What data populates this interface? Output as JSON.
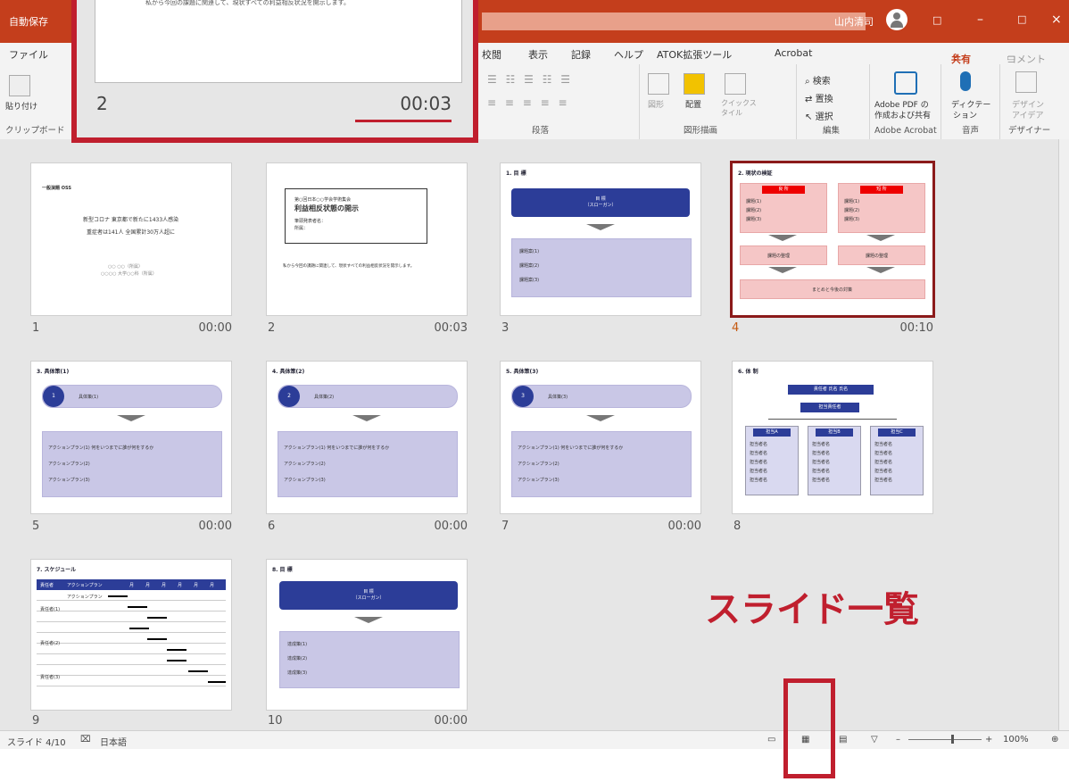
{
  "titlebar": {
    "autosave": "自動保存",
    "user_name": "山内清司",
    "btn_ribbon_display": "□",
    "btn_minimize": "–",
    "btn_maximize": "□",
    "btn_close": "×"
  },
  "ribbon_tabs": [
    "ファイル",
    "校閲",
    "表示",
    "記録",
    "ヘルプ",
    "ATOK拡張ツール",
    "Acrobat"
  ],
  "ribbon_right": {
    "share": "共有",
    "comment": "コメント"
  },
  "ribbon": {
    "paste": "貼り付け",
    "clipboard_label": "クリップボード",
    "paragraph_label": "段落",
    "shapes_label": "図形",
    "arrange": "配置",
    "quick_styles": "クイックスタイル",
    "drawing_label": "図形描画",
    "find": "検索",
    "replace": "置換",
    "select": "選択",
    "editing_label": "編集",
    "acrobat_btn_line1": "Adobe PDF の",
    "acrobat_btn_line2": "作成および共有",
    "acrobat_label": "Adobe Acrobat",
    "dictation_line1": "ディクテー",
    "dictation_line2": "ション",
    "voice_label": "音声",
    "designer_line1": "デザイン",
    "designer_line2": "アイデア",
    "designer_label": "デザイナー"
  },
  "zoom_overlay": {
    "caption": "私から今回の課題に関連して、現状すべての利益相反状況を開示します。",
    "number": "2",
    "time": "00:03"
  },
  "slides": [
    {
      "num": "1",
      "time": "00:00",
      "title": "一般演題 OSS",
      "lines": [
        "新型コロナ 東京都で新たに1433人感染",
        "重症者は141人 全国累計30万人超に"
      ],
      "footer": [
        "○○ ○○（所属）",
        "○○○○ 大学○○科（所属）"
      ]
    },
    {
      "num": "2",
      "time": "00:03",
      "box_title_small": "第○回日本○○学会学術集会",
      "box_title": "利益相反状態の開示",
      "box_lines": [
        "筆頭発表者名：",
        "所属："
      ],
      "caption": "私から今回の課題に関連して、現状すべての利益相反状況を開示します。"
    },
    {
      "num": "3",
      "time": "",
      "title": "1. 目 標",
      "blue_box": [
        "目 標",
        "（スローガン）"
      ],
      "items": [
        "課題案(1)",
        "課題案(2)",
        "課題案(3)"
      ]
    },
    {
      "num": "4",
      "time": "00:10",
      "title": "2. 現状の検証",
      "left_label": "良 所",
      "right_label": "短 所",
      "left_items": [
        "課題(1)",
        "課題(2)",
        "課題(3)"
      ],
      "right_items": [
        "課題(1)",
        "課題(2)",
        "課題(3)"
      ],
      "mid_left": "課題の整理",
      "mid_right": "課題の整理",
      "bottom": "まとめと今後の対策"
    },
    {
      "num": "5",
      "time": "00:00",
      "title": "3. 具体策(1)",
      "circle": "1",
      "circle_label": "具体策(1)",
      "items": [
        "アクションプラン(1) 何をいつまでに誰が何をするか",
        "アクションプラン(2)",
        "アクションプラン(3)"
      ]
    },
    {
      "num": "6",
      "time": "00:00",
      "title": "4. 具体策(2)",
      "circle": "2",
      "circle_label": "具体策(2)",
      "items": [
        "アクションプラン(1) 何をいつまでに誰が何をするか",
        "アクションプラン(2)",
        "アクションプラン(3)"
      ]
    },
    {
      "num": "7",
      "time": "00:00",
      "title": "5. 具体策(3)",
      "circle": "3",
      "circle_label": "具体策(3)",
      "items": [
        "アクションプラン(1) 何をいつまでに誰が何をするか",
        "アクションプラン(2)",
        "アクションプラン(3)"
      ]
    },
    {
      "num": "8",
      "time": "",
      "title": "6. 体 制",
      "top_box": "責任者 氏名 氏名",
      "mid_box": "担当責任者",
      "teams": [
        "担当A",
        "担当B",
        "担当C"
      ],
      "members": [
        "担当者名",
        "担当者名",
        "担当者名",
        "担当者名",
        "担当者名"
      ]
    },
    {
      "num": "9",
      "time": "",
      "title": "7. スケジュール",
      "cols": [
        "責任者",
        "アクションプラン",
        "月",
        "月",
        "月",
        "月",
        "月",
        "月",
        "月"
      ],
      "rows": [
        "責任者(1)",
        "責任者(2)",
        "責任者(3)"
      ],
      "plan": "アクションプラン"
    },
    {
      "num": "10",
      "time": "00:00",
      "title": "8. 目 標",
      "blue_box": [
        "目 標",
        "（スローガン）"
      ],
      "items": [
        "達成策(1)",
        "達成策(2)",
        "達成策(3)"
      ]
    }
  ],
  "statusbar": {
    "slide_pos": "スライド 4/10",
    "lang": "日本語",
    "zoom": "100%"
  },
  "annotation": {
    "title": "スライド一覧"
  }
}
